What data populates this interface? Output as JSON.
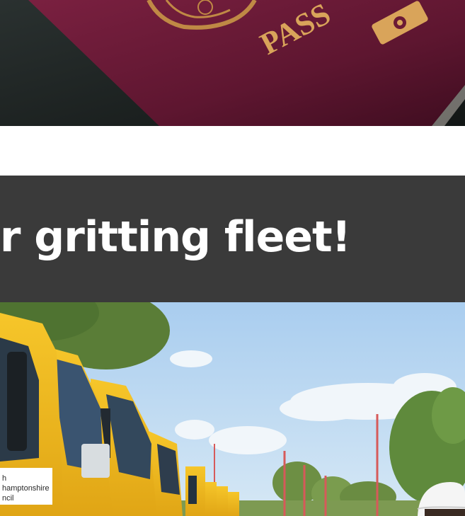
{
  "passport_photo": {
    "cover_text": "PASS",
    "cover_color": "#6b1a35",
    "emboss_color": "#d9a45a"
  },
  "headline": {
    "text": "our gritting fleet!",
    "background": "#3a3a3a"
  },
  "fleet_photo": {
    "truck_label_lines": [
      "h",
      "hamptonshire",
      "ncil"
    ],
    "truck_color": "#f0b820",
    "sky_color": "#bcd8ef"
  }
}
